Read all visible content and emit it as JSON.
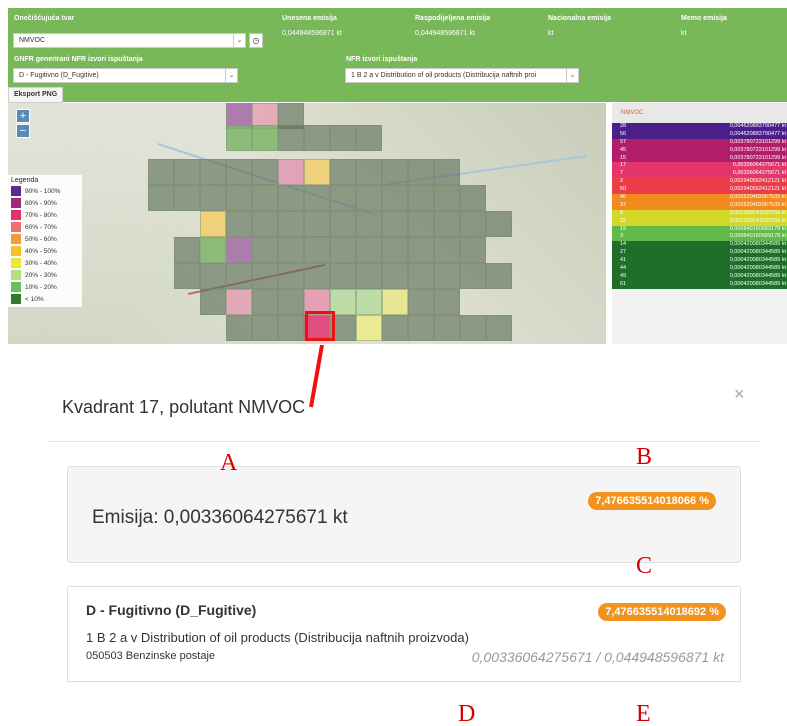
{
  "topbar": {
    "pollutant_label": "Onečišćujuća tvar",
    "pollutant_value": "NMVOC",
    "entered_label": "Unesena emisija",
    "entered_value": "0,044948596871 kt",
    "distributed_label": "Raspodijeljena emisija",
    "distributed_value": "0,044948596871 kt",
    "national_label": "Nacionalna emisija",
    "national_value": "kt",
    "memo_label": "Memo emisija",
    "memo_value": "kt",
    "gnfr_label": "GNFR generirani NFR izvori ispuštanja",
    "gnfr_value": "D - Fugitivno (D_Fugitive)",
    "nfr_label": "NFR izvori ispuštanja",
    "nfr_value": "1 B 2 a v Distribution of oil products (Distribucija naftnih proi",
    "export_label": "Eksport PNG"
  },
  "map": {
    "zoom_in": "+",
    "zoom_out": "−",
    "legend_title": "Legenda",
    "legend": [
      {
        "label": "90% - 100%",
        "color": "#5b2c8f"
      },
      {
        "label": "80% - 90%",
        "color": "#a0287a"
      },
      {
        "label": "70% - 80%",
        "color": "#e0306e"
      },
      {
        "label": "60% - 70%",
        "color": "#f07070"
      },
      {
        "label": "50% - 60%",
        "color": "#f59a3a"
      },
      {
        "label": "40% - 50%",
        "color": "#f7c02c"
      },
      {
        "label": "30% - 40%",
        "color": "#e8e838"
      },
      {
        "label": "20% - 30%",
        "color": "#b8e07a"
      },
      {
        "label": "10% - 20%",
        "color": "#6cc05c"
      },
      {
        "label": "< 10%",
        "color": "#2e7d32"
      }
    ]
  },
  "color_table": {
    "header": "NMVOC",
    "rows": [
      {
        "id": "28",
        "value": "0,004620883790477 kt",
        "color": "#4b1f8a"
      },
      {
        "id": "56",
        "value": "0,004620883790477 kt",
        "color": "#4b1f8a"
      },
      {
        "id": "57",
        "value": "0,003780723101299 kt",
        "color": "#b21e6a"
      },
      {
        "id": "45",
        "value": "0,003780723101299 kt",
        "color": "#b21e6a"
      },
      {
        "id": "15",
        "value": "0,003780723101299 kt",
        "color": "#b21e6a"
      },
      {
        "id": "17",
        "value": "0,00336064275671 kt",
        "color": "#e4356f"
      },
      {
        "id": "7",
        "value": "0,00336064275671 kt",
        "color": "#e4356f"
      },
      {
        "id": "2",
        "value": "0,002940562412121 kt",
        "color": "#ec3c48"
      },
      {
        "id": "50",
        "value": "0,002940562412121 kt",
        "color": "#ec3c48"
      },
      {
        "id": "46",
        "value": "0,002520482067533 kt",
        "color": "#f28a1e"
      },
      {
        "id": "37",
        "value": "0,002520482067533 kt",
        "color": "#f28a1e"
      },
      {
        "id": "8",
        "value": "0,001260241033766 kt",
        "color": "#d2d928"
      },
      {
        "id": "22",
        "value": "0,001260241033766 kt",
        "color": "#d2d928"
      },
      {
        "id": "19",
        "value": "0,000840160689178 kt",
        "color": "#62b947"
      },
      {
        "id": "3",
        "value": "0,000840160689178 kt",
        "color": "#62b947"
      },
      {
        "id": "14",
        "value": "0,000420080344589 kt",
        "color": "#1f6e2a"
      },
      {
        "id": "27",
        "value": "0,000420080344589 kt",
        "color": "#1f6e2a"
      },
      {
        "id": "41",
        "value": "0,000420080344589 kt",
        "color": "#1f6e2a"
      },
      {
        "id": "44",
        "value": "0,000420080344589 kt",
        "color": "#1f6e2a"
      },
      {
        "id": "49",
        "value": "0,000420080344589 kt",
        "color": "#1f6e2a"
      },
      {
        "id": "61",
        "value": "0,000420080344589 kt",
        "color": "#1f6e2a"
      }
    ]
  },
  "modal": {
    "title": "Kvadrant 17, polutant NMVOC",
    "close": "×",
    "emission_text": "Emisija: 0,00336064275671 kt",
    "emission_badge": "7,476635514018066 %",
    "detail_title": "D - Fugitivno (D_Fugitive)",
    "detail_badge": "7,476635514018692 %",
    "detail_line1": "1 B 2 a v Distribution of oil products (Distribucija naftnih proizvoda)",
    "detail_line2": "050503 Benzinske postaje",
    "detail_ratio": "0,00336064275671 / 0,044948596871 kt"
  },
  "annotations": {
    "a": "A",
    "b": "B",
    "c": "C",
    "d": "D",
    "e": "E"
  }
}
